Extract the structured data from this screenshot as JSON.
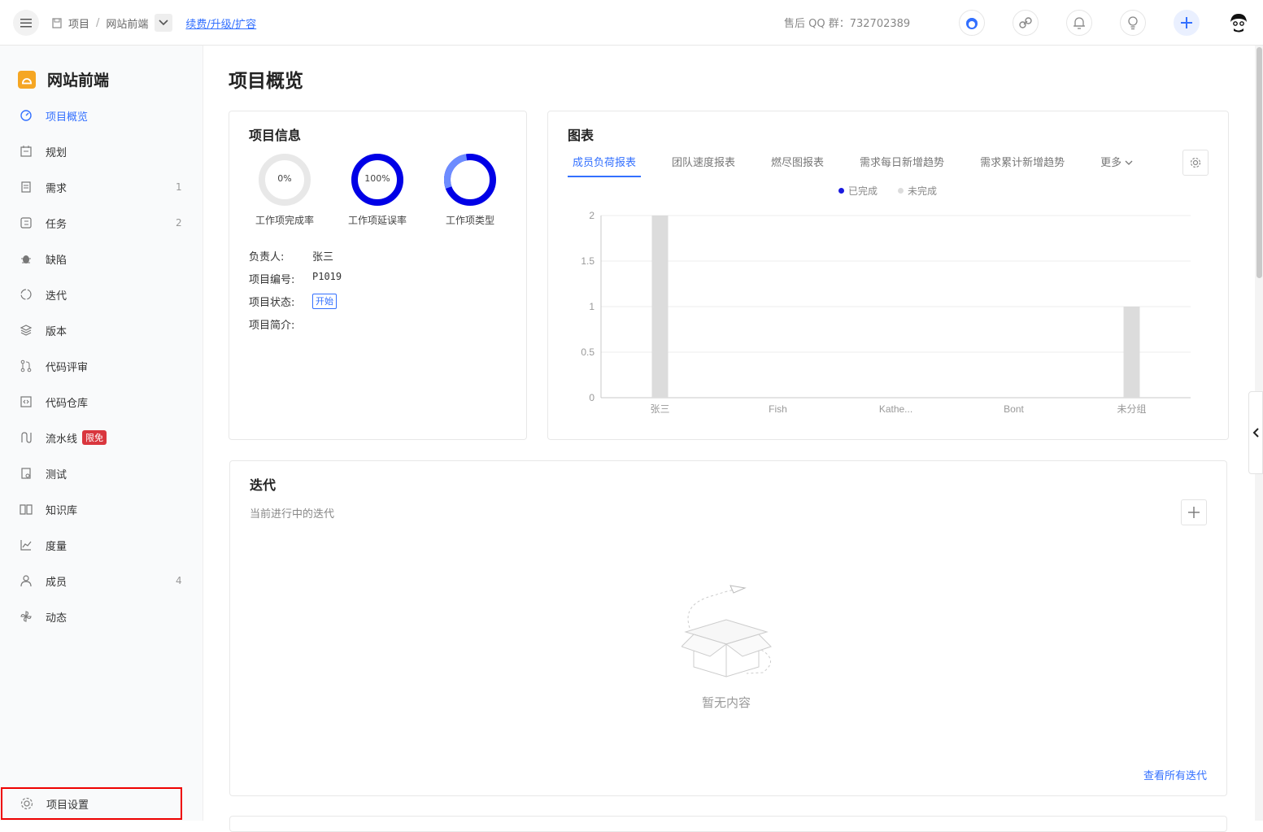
{
  "breadcrumb": {
    "root": "项目",
    "separator": "/",
    "current": "网站前端"
  },
  "topbar": {
    "renew_link": "续费/升级/扩容",
    "support": "售后 QQ 群：732702389"
  },
  "project": {
    "name": "网站前端"
  },
  "sidebar": {
    "items": [
      {
        "label": "项目概览",
        "icon": "dashboard-icon",
        "active": true
      },
      {
        "label": "规划",
        "icon": "calendar-icon"
      },
      {
        "label": "需求",
        "icon": "document-icon",
        "count": "1"
      },
      {
        "label": "任务",
        "icon": "task-list-icon",
        "count": "2"
      },
      {
        "label": "缺陷",
        "icon": "bug-icon"
      },
      {
        "label": "迭代",
        "icon": "cycle-icon"
      },
      {
        "label": "版本",
        "icon": "layers-icon"
      },
      {
        "label": "代码评审",
        "icon": "pull-request-icon"
      },
      {
        "label": "代码仓库",
        "icon": "code-icon"
      },
      {
        "label": "流水线",
        "icon": "pipeline-icon",
        "badge": "限免"
      },
      {
        "label": "测试",
        "icon": "test-icon"
      },
      {
        "label": "知识库",
        "icon": "book-icon"
      },
      {
        "label": "度量",
        "icon": "chart-line-icon"
      },
      {
        "label": "成员",
        "icon": "user-icon",
        "count": "4"
      },
      {
        "label": "动态",
        "icon": "activity-icon"
      }
    ],
    "settings_label": "项目设置"
  },
  "page_title": "项目概览",
  "info_card": {
    "title": "项目信息",
    "donuts": [
      {
        "value": "0%",
        "label": "工作项完成率",
        "fraction": 0
      },
      {
        "value": "100%",
        "label": "工作项延误率",
        "fraction": 1
      },
      {
        "value": "",
        "label": "工作项类型",
        "fraction": 1
      }
    ],
    "fields": [
      {
        "key": "负责人:",
        "value": "张三"
      },
      {
        "key": "项目编号:",
        "value": "P1019"
      },
      {
        "key": "项目状态:",
        "value": "开始"
      },
      {
        "key": "项目简介:",
        "value": ""
      }
    ]
  },
  "chart_card": {
    "title": "图表",
    "tabs": [
      "成员负荷报表",
      "团队速度报表",
      "燃尽图报表",
      "需求每日新增趋势",
      "需求累计新增趋势",
      "更多"
    ]
  },
  "chart_data": {
    "type": "bar",
    "categories": [
      "张三",
      "Fish",
      "Kathe...",
      "Bont",
      "未分组"
    ],
    "series": [
      {
        "name": "已完成",
        "values": [
          0,
          0,
          0,
          0,
          0
        ],
        "color": "#1a1adf"
      },
      {
        "name": "未完成",
        "values": [
          2,
          0,
          0,
          0,
          1
        ],
        "color": "#dcdcdc"
      }
    ],
    "y_ticks": [
      "0",
      "0.5",
      "1",
      "1.5",
      "2"
    ],
    "ylim": [
      0,
      2
    ],
    "grid": true,
    "legend_position": "top-center"
  },
  "iteration_card": {
    "title": "迭代",
    "subtitle": "当前进行中的迭代",
    "empty_text": "暂无内容",
    "view_all": "查看所有迭代"
  },
  "colors": {
    "accent": "#3370ff",
    "donut_blue": "#0000e6",
    "badge_red": "#d9363e"
  }
}
